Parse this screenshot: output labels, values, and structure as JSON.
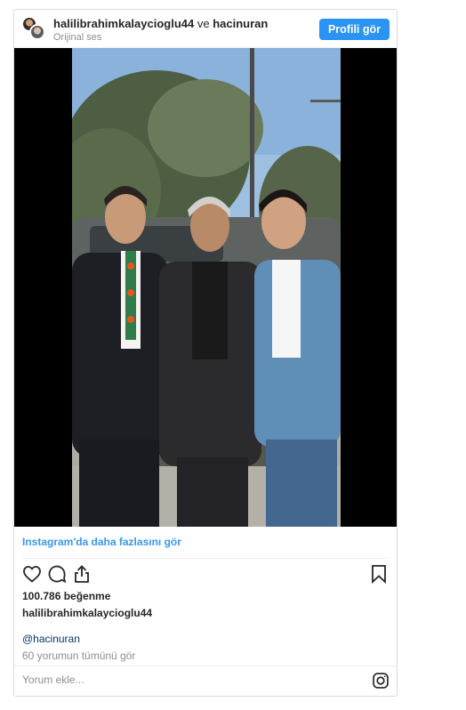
{
  "post": {
    "author_primary": "halilibrahimkalaycioglu44",
    "conjunction": "ve",
    "author_secondary": "hacinuran",
    "audio_label": "Orijinal ses",
    "profile_button": "Profili gör"
  },
  "media": {
    "more_link": "Instagram'da daha fazlasını gör"
  },
  "actions": {
    "like_icon": "heart-outline-icon",
    "comment_icon": "speech-bubble-icon",
    "share_icon": "share-upload-icon",
    "save_icon": "bookmark-icon"
  },
  "engagement": {
    "likes_text": "100.786 beğenme",
    "caption_user": "halilibrahimkalaycioglu44",
    "mention": "@hacinuran",
    "view_comments": "60 yorumun tümünü gör"
  },
  "comment_box": {
    "placeholder": "Yorum ekle...",
    "brand_icon": "instagram-icon"
  },
  "colors": {
    "accent": "#3897f0",
    "button_bg": "#2a93f3",
    "muted": "#8e8e8e",
    "border": "#dbdbdb"
  }
}
